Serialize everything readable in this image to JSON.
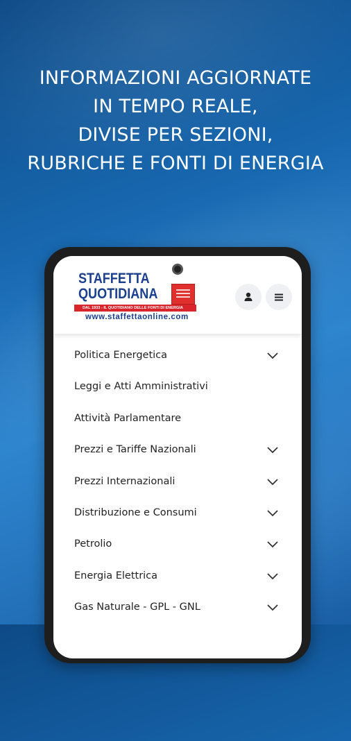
{
  "headline": {
    "line1": "INFORMAZIONI AGGIORNATE",
    "line2": "IN TEMPO REALE,",
    "line3": "DIVISE PER SEZIONI,",
    "line4": "RUBRICHE E FONTI DI ENERGIA"
  },
  "logo": {
    "title_line1": "STAFFETTA",
    "title_line2": "QUOTIDIANA",
    "tagline": "DAL 1933 - IL QUOTIDIANO DELLE FONTI DI ENERGIA",
    "url": "www.staffettaonline.com"
  },
  "header": {
    "user_icon": "user-icon",
    "menu_icon": "hamburger-menu-icon"
  },
  "menu": {
    "items": [
      {
        "label": "Politica Energetica",
        "expandable": true
      },
      {
        "label": "Leggi e Atti Amministrativi",
        "expandable": false
      },
      {
        "label": "Attività Parlamentare",
        "expandable": false
      },
      {
        "label": "Prezzi e Tariffe Nazionali",
        "expandable": true
      },
      {
        "label": "Prezzi Internazionali",
        "expandable": true
      },
      {
        "label": "Distribuzione e Consumi",
        "expandable": true
      },
      {
        "label": "Petrolio",
        "expandable": true
      },
      {
        "label": "Energia Elettrica",
        "expandable": true
      },
      {
        "label": "Gas Naturale - GPL - GNL",
        "expandable": true
      }
    ]
  },
  "colors": {
    "background_blue": "#1868b0",
    "brand_blue": "#1b3f8f",
    "brand_red": "#d8242a"
  }
}
